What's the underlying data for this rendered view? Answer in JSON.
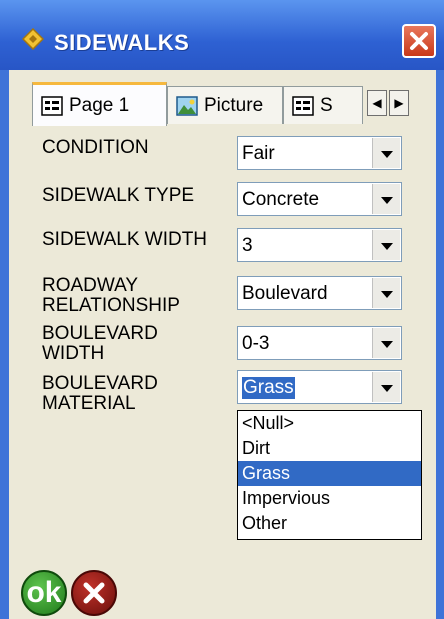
{
  "window": {
    "title": "SIDEWALKS"
  },
  "tabs": [
    {
      "label": "Page 1",
      "icon": "form-icon"
    },
    {
      "label": "Picture",
      "icon": "picture-icon"
    },
    {
      "label": "S",
      "icon": "form-icon"
    }
  ],
  "fields": [
    {
      "label": "CONDITION",
      "value": "Fair"
    },
    {
      "label": "SIDEWALK TYPE",
      "value": "Concrete"
    },
    {
      "label": "SIDEWALK WIDTH",
      "value": "3"
    },
    {
      "label": "ROADWAY RELATIONSHIP",
      "value": "Boulevard"
    },
    {
      "label": "BOULEVARD WIDTH",
      "value": "0-3"
    },
    {
      "label": "BOULEVARD MATERIAL",
      "value": "Grass"
    }
  ],
  "dropdown": {
    "options": [
      "<Null>",
      "Dirt",
      "Grass",
      "Impervious",
      "Other"
    ],
    "selected": "Grass"
  },
  "buttons": {
    "ok_label": "ok"
  },
  "colors": {
    "titlebar": "#2e61d3",
    "selection": "#316ac5",
    "ok": "#1f7a1a",
    "cancel": "#a01f18"
  }
}
